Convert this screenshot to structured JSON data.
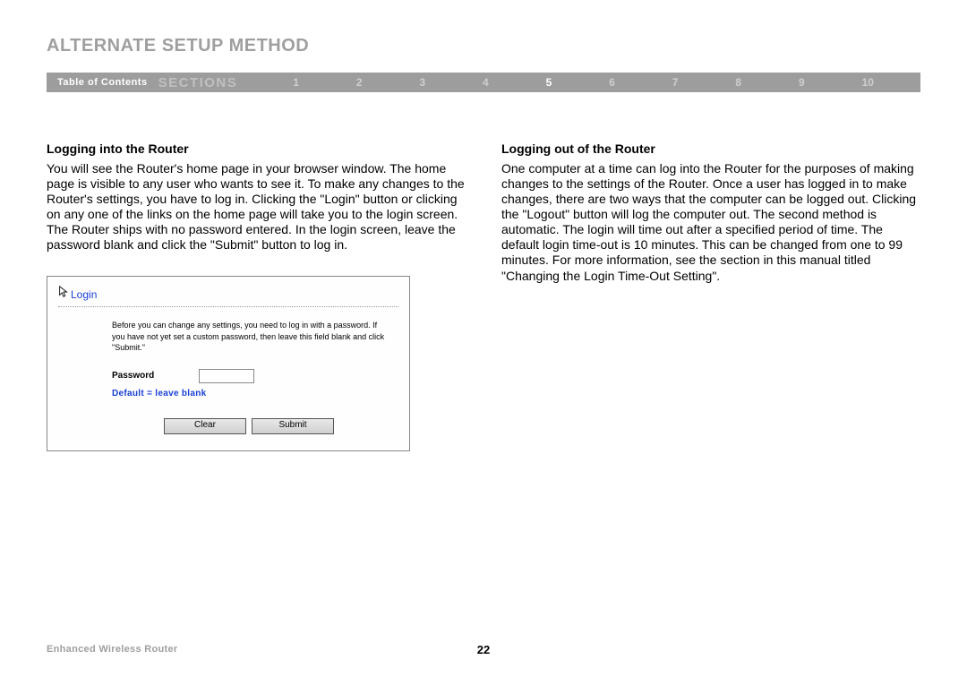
{
  "header": {
    "title": "ALTERNATE SETUP METHOD"
  },
  "nav": {
    "toc": "Table of Contents",
    "sections_label": "SECTIONS",
    "numbers": [
      "1",
      "2",
      "3",
      "4",
      "5",
      "6",
      "7",
      "8",
      "9",
      "10"
    ],
    "active_index": 4
  },
  "left": {
    "heading": "Logging into the Router",
    "body": "You will see the Router's home page in your browser window. The home page is visible to any user who wants to see it. To make any changes to the Router's settings, you have to log in. Clicking the \"Login\" button or clicking on any one of the links on the home page will take you to the login screen. The Router ships with no password entered. In the login screen, leave the password blank and click the \"Submit\" button to log in."
  },
  "login_panel": {
    "title": "Login",
    "desc": "Before you can change any settings, you need to log in with a password. If you have not yet set a custom password, then leave this field blank and click \"Submit.\"",
    "password_label": "Password",
    "password_value": "",
    "default_hint": "Default = leave blank",
    "clear_btn": "Clear",
    "submit_btn": "Submit"
  },
  "right": {
    "heading": "Logging out of the Router",
    "body": "One computer at a time can log into the Router for the purposes of making changes to the settings of the Router. Once a user has logged in to make changes, there are two ways that the computer can be logged out. Clicking the \"Logout\" button will log the computer out. The second method is automatic. The login will time out after a specified period of time. The default login time-out is 10 minutes. This can be changed from one to 99 minutes. For more information, see the section in this manual titled \"Changing the Login Time-Out Setting\"."
  },
  "footer": {
    "product": "Enhanced Wireless Router",
    "page": "22"
  }
}
